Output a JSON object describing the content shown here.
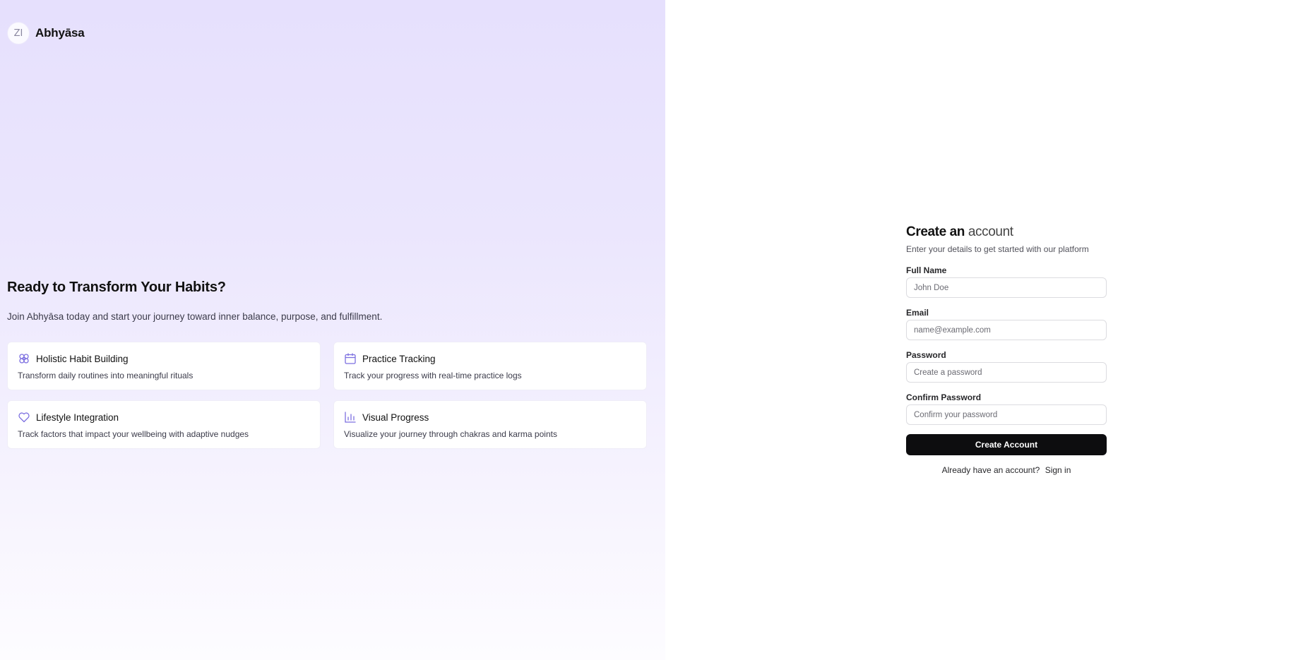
{
  "brand": {
    "logo_glyph": "ZI",
    "name": "Abhyāsa"
  },
  "hero": {
    "title": "Ready to Transform Your Habits?",
    "subtitle": "Join Abhyāsa today and start your journey toward inner balance, purpose, and fulfillment."
  },
  "features": [
    {
      "icon": "flower-icon",
      "title": "Holistic Habit Building",
      "description": "Transform daily routines into meaningful rituals"
    },
    {
      "icon": "calendar-icon",
      "title": "Practice Tracking",
      "description": "Track your progress with real-time practice logs"
    },
    {
      "icon": "heart-icon",
      "title": "Lifestyle Integration",
      "description": "Track factors that impact your wellbeing with adaptive nudges"
    },
    {
      "icon": "bar-chart-icon",
      "title": "Visual Progress",
      "description": "Visualize your journey through chakras and karma points"
    }
  ],
  "form": {
    "title_main": "Create an",
    "title_accent": "account",
    "subtitle": "Enter your details to get started with our platform",
    "fields": [
      {
        "label": "Full Name",
        "placeholder": "John Doe",
        "value": ""
      },
      {
        "label": "Email",
        "placeholder": "name@example.com",
        "value": ""
      },
      {
        "label": "Password",
        "placeholder": "Create a password",
        "value": ""
      },
      {
        "label": "Confirm Password",
        "placeholder": "Confirm your password",
        "value": ""
      }
    ],
    "submit_label": "Create Account",
    "footer_text": "Already have an account?",
    "footer_link": "Sign in"
  },
  "colors": {
    "accent_purple": "#7c6fe0",
    "gradient_top": "#e6e0fd",
    "button_bg": "#0d0d0f"
  }
}
